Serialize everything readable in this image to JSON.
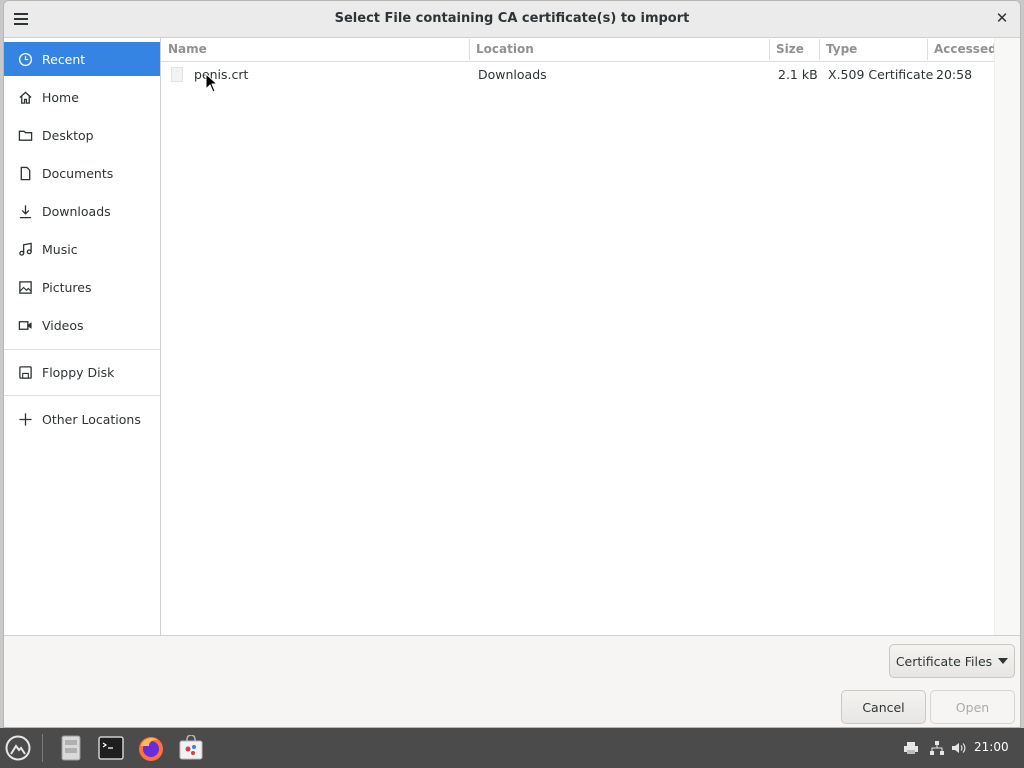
{
  "dialog": {
    "title": "Select File containing CA certificate(s) to import"
  },
  "sidebar": {
    "items": [
      {
        "label": "Recent",
        "icon": "clock-icon",
        "active": true
      },
      {
        "label": "Home",
        "icon": "home-icon"
      },
      {
        "label": "Desktop",
        "icon": "folder-icon"
      },
      {
        "label": "Documents",
        "icon": "document-icon"
      },
      {
        "label": "Downloads",
        "icon": "download-icon"
      },
      {
        "label": "Music",
        "icon": "music-icon"
      },
      {
        "label": "Pictures",
        "icon": "picture-icon"
      },
      {
        "label": "Videos",
        "icon": "video-icon"
      },
      {
        "label": "Floppy Disk",
        "icon": "floppy-icon"
      },
      {
        "label": "Other Locations",
        "icon": "plus-icon"
      }
    ]
  },
  "columns": {
    "name": "Name",
    "location": "Location",
    "size": "Size",
    "type": "Type",
    "accessed": "Accessed"
  },
  "files": [
    {
      "name": "penis.crt",
      "location": "Downloads",
      "size": "2.1 kB",
      "type": "X.509 Certificate",
      "accessed": "20:58"
    }
  ],
  "filter": {
    "label": "Certificate Files"
  },
  "buttons": {
    "cancel": "Cancel",
    "open": "Open"
  },
  "taskbar": {
    "clock": "21:00",
    "apps": [
      "file-manager-icon",
      "terminal-icon",
      "firefox-icon",
      "software-store-icon"
    ]
  },
  "colors": {
    "accent": "#3584e4",
    "taskbar": "#4b4b4b"
  }
}
